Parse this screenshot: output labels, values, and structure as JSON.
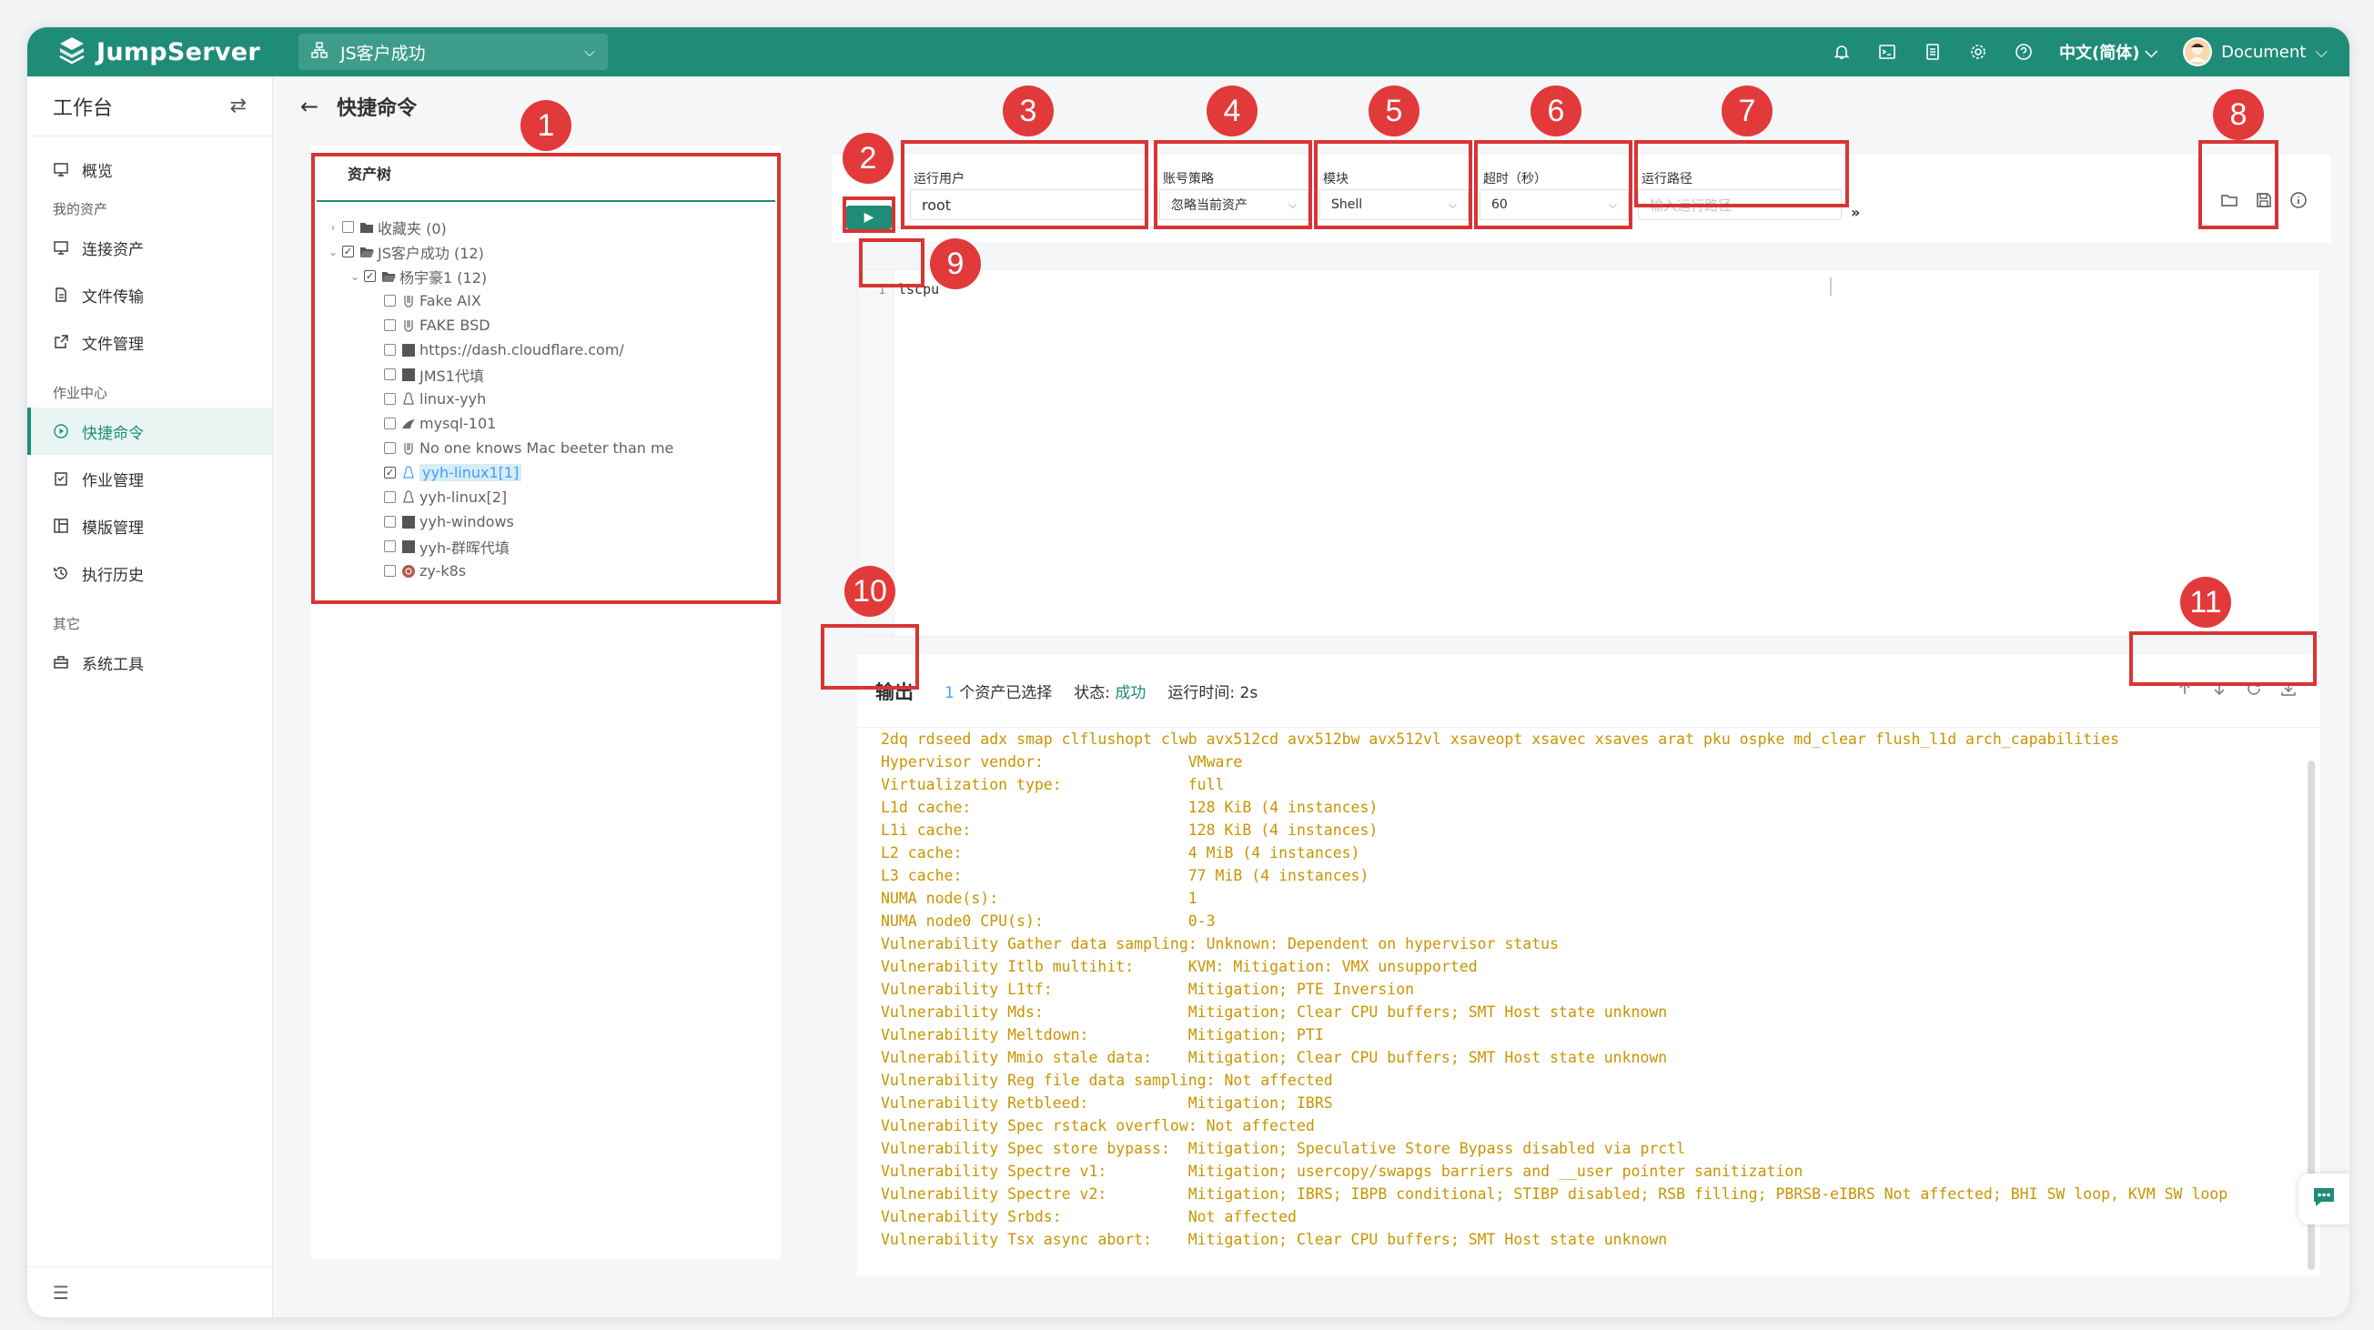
{
  "topbar": {
    "logo_text": "JumpServer",
    "org": "JS客户成功",
    "lang": "中文(简体)",
    "user": "Document"
  },
  "sidebar": {
    "title": "工作台",
    "groups": {
      "my_assets": "我的资产",
      "job_center": "作业中心",
      "other": "其它"
    },
    "items": {
      "overview": "概览",
      "connect": "连接资产",
      "file_transfer": "文件传输",
      "file_manage": "文件管理",
      "quick_cmd": "快捷命令",
      "job_manage": "作业管理",
      "template_manage": "模版管理",
      "history": "执行历史",
      "sys_tools": "系统工具"
    }
  },
  "page": {
    "title": "快捷命令"
  },
  "tree": {
    "title": "资产树",
    "nodes": [
      {
        "label": "收藏夹 (0)"
      },
      {
        "label": "JS客户成功 (12)"
      },
      {
        "label": "杨宇豪1 (12)"
      },
      {
        "label": "Fake AIX"
      },
      {
        "label": "FAKE BSD"
      },
      {
        "label": "https://dash.cloudflare.com/"
      },
      {
        "label": "JMS1代填"
      },
      {
        "label": "linux-yyh"
      },
      {
        "label": "mysql-101"
      },
      {
        "label": "No one knows Mac beeter than me"
      },
      {
        "label": "yyh-linux1[1]"
      },
      {
        "label": "yyh-linux[2]"
      },
      {
        "label": "yyh-windows"
      },
      {
        "label": "yyh-群晖代填"
      },
      {
        "label": "zy-k8s"
      }
    ]
  },
  "toolbar": {
    "run_user_label": "运行用户",
    "run_user_value": "root",
    "account_policy_label": "账号策略",
    "account_policy_value": "忽略当前资产",
    "module_label": "模块",
    "module_value": "Shell",
    "timeout_label": "超时（秒）",
    "timeout_value": "60",
    "path_label": "运行路径",
    "path_placeholder": "输入运行路径"
  },
  "editor": {
    "line_no": "1",
    "code": "lscpu"
  },
  "output": {
    "title": "输出",
    "selected_count": "1",
    "selected_text": "个资产已选择",
    "status_label": "状态:",
    "status_value": "成功",
    "runtime": "运行时间: 2s",
    "lines": [
      "2dq rdseed adx smap clflushopt clwb avx512cd avx512bw avx512vl xsaveopt xsavec xsaves arat pku ospke md_clear flush_l1d arch_capabilities",
      "Hypervisor vendor:                VMware",
      "Virtualization type:              full",
      "L1d cache:                        128 KiB (4 instances)",
      "L1i cache:                        128 KiB (4 instances)",
      "L2 cache:                         4 MiB (4 instances)",
      "L3 cache:                         77 MiB (4 instances)",
      "NUMA node(s):                     1",
      "NUMA node0 CPU(s):                0-3",
      "Vulnerability Gather data sampling: Unknown: Dependent on hypervisor status",
      "Vulnerability Itlb multihit:      KVM: Mitigation: VMX unsupported",
      "Vulnerability L1tf:               Mitigation; PTE Inversion",
      "Vulnerability Mds:                Mitigation; Clear CPU buffers; SMT Host state unknown",
      "Vulnerability Meltdown:           Mitigation; PTI",
      "Vulnerability Mmio stale data:    Mitigation; Clear CPU buffers; SMT Host state unknown",
      "Vulnerability Reg file data sampling: Not affected",
      "Vulnerability Retbleed:           Mitigation; IBRS",
      "Vulnerability Spec rstack overflow: Not affected",
      "Vulnerability Spec store bypass:  Mitigation; Speculative Store Bypass disabled via prctl",
      "Vulnerability Spectre v1:         Mitigation; usercopy/swapgs barriers and __user pointer sanitization",
      "Vulnerability Spectre v2:         Mitigation; IBRS; IBPB conditional; STIBP disabled; RSB filling; PBRSB-eIBRS Not affected; BHI SW loop, KVM SW loop",
      "Vulnerability Srbds:              Not affected",
      "Vulnerability Tsx async abort:    Mitigation; Clear CPU buffers; SMT Host state unknown"
    ]
  },
  "annotations": [
    "1",
    "2",
    "3",
    "4",
    "5",
    "6",
    "7",
    "8",
    "9",
    "10",
    "11"
  ],
  "colors": {
    "brand": "#1f8c77",
    "annotation": "#e23a3a",
    "output_text": "#c99400"
  }
}
